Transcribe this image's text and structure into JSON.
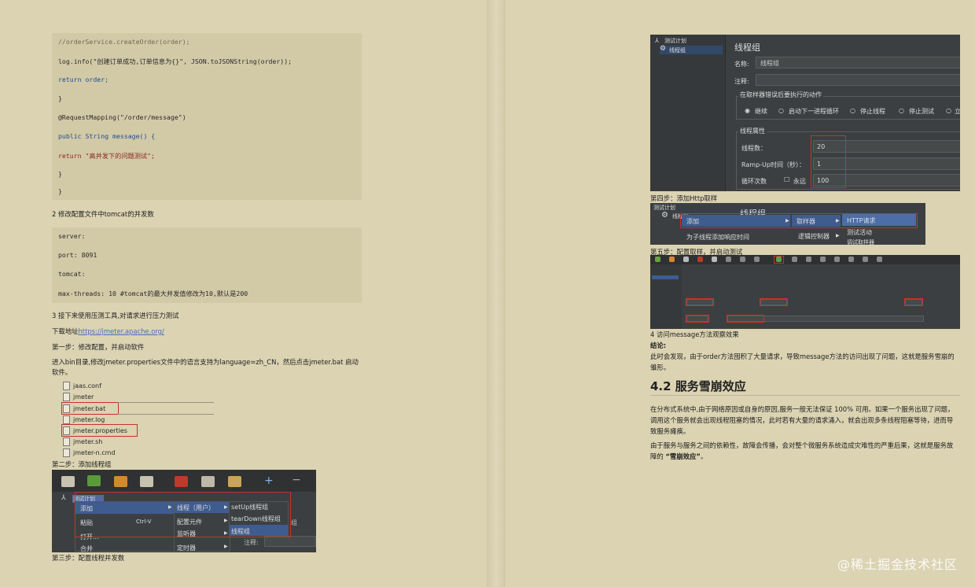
{
  "left": {
    "code1": [
      "//orderService.createOrder(order);",
      "log.info(\"创建订单成功,订单信息为{}\", JSON.toJSONString(order));",
      "return order;",
      "}",
      "@RequestMapping(\"/order/message\")",
      "public String message() {",
      "return \"高并发下的问题测试\";",
      "}",
      "}"
    ],
    "step2_text": "2 修改配置文件中tomcat的并发数",
    "code2": [
      "server:",
      "port: 8091",
      "tomcat:",
      "max-threads: 10 #tomcat的最大并发值修改为10,默认是200"
    ],
    "step3_text": "3 接下来使用压测工具,对请求进行压力测试",
    "download_prefix": "下载地址",
    "download_link": "https://jmeter.apache.org/",
    "first_step": "第一步：修改配置，并启动软件",
    "first_step_desc": "进入bin目录,修改jmeter.properties文件中的语言支持为language=zh_CN，然后点击jmeter.bat 启动软件。",
    "files": [
      "jaas.conf",
      "jmeter",
      "jmeter.bat",
      "jmeter.log",
      "jmeter.properties",
      "jmeter.sh",
      "jmeter-n.cmd"
    ],
    "second_step": "第二步：添加线程组",
    "menu_shot": {
      "tree_root": "测试计划",
      "add": "添加",
      "paste": "粘贴",
      "paste_key": "Ctrl-V",
      "open": "打开...",
      "merge": "合并",
      "threads_users": "线程（用户）",
      "config": "配置元件",
      "listener": "监听器",
      "timer": "定时器",
      "setup": "setUp线程组",
      "teardown": "tearDown线程组",
      "thread_group": "线程组",
      "comment": "注释:",
      "peek": "组"
    },
    "third_step": "第三步：配置线程并发数"
  },
  "right": {
    "tg_shot": {
      "tree_root": "测试计划",
      "tree_child": "线程组",
      "title": "线程组",
      "name_label": "名称:",
      "name_value": "线程组",
      "comment_label": "注释:",
      "error_legend": "在取样器错误后要执行的动作",
      "opt_continue": "继续",
      "opt_next_loop": "启动下一进程循环",
      "opt_stop_thread": "停止线程",
      "opt_stop_test": "停止测试",
      "opt_stop_now": "立",
      "props_legend": "线程属性",
      "threads_label": "线程数：",
      "threads_value": "20",
      "rampup_label": "Ramp-Up时间（秒）：",
      "rampup_value": "1",
      "loop_label": "循环次数",
      "forever_label": "永远",
      "loop_value": "100"
    },
    "step4": "第四步：添加Http取样",
    "http_shot": {
      "tree_root": "测试计划",
      "tree_child": "线程组",
      "title": "线程组",
      "add": "添加",
      "sampler": "取样器",
      "http_request": "HTTP请求",
      "debug_sampler": "测试活动",
      "extra": "调试取样器",
      "sub_hint": "为子线程添加响应时间",
      "logic": "逻辑控制器"
    },
    "step5": "第五步：配置取样，并启动测试",
    "visit_text": "4 访问message方法观察效果",
    "conclusion_label": "结论:",
    "conclusion_text": "此时会发现，由于order方法囤积了大量请求，导致message方法的访问出现了问题，这就是服务雪崩的雏形。",
    "heading": "4.2 服务雪崩效应",
    "para1": "在分布式系统中,由于网络原因或自身的原因,服务一般无法保证 100% 可用。如果一个服务出现了问题，调用这个服务就会出现线程阻塞的情况，此时若有大量的请求涌入，就会出现多条线程阻塞等待，进而导致服务瘫痪。",
    "para2_prefix": "由于服务与服务之间的依赖性，故障会传播，会对整个微服务系统造成灾难性的严重后果，这就是服务故障的 ",
    "para2_bold": "“雪崩效应”",
    "para2_suffix": "。"
  },
  "watermark": "@稀土掘金技术社区"
}
